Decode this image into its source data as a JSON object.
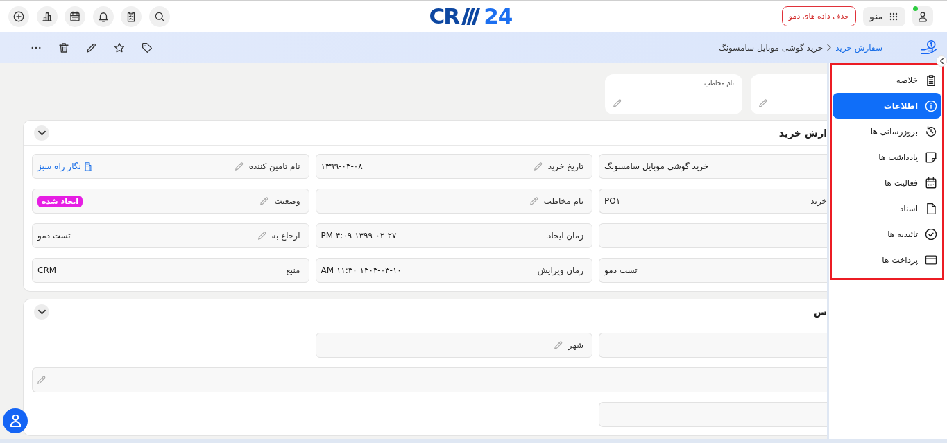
{
  "header": {
    "logo": {
      "part_1": "CR",
      "part_2": "24"
    },
    "delete_demo_button": "حذف داده های دمو",
    "menu_button": "منو",
    "user": {
      "online": true
    }
  },
  "toolbar": {
    "breadcrumb": [
      {
        "label": "سفارش خرید",
        "current": false
      },
      {
        "label": "خرید گوشی موبایل سامسونگ",
        "current": true
      }
    ]
  },
  "summary_cards": [
    {
      "editable": true
    },
    {
      "label": "نام مخاطب",
      "editable": true
    }
  ],
  "sections": [
    {
      "title": "ارش خرید",
      "rows": [
        {
          "kind": "grid",
          "fields": [
            {
              "kind": "text",
              "value": "خرید گوشی موبایل سامسونگ",
              "editable": false
            },
            {
              "kind": "text",
              "label": "تاریخ خرید",
              "value": "۱۳۹۹-۰۳-۰۸",
              "editable": true
            },
            {
              "kind": "link",
              "label": "نام تامین کننده",
              "value": "نگار راه سبز",
              "editable": true
            }
          ]
        },
        {
          "kind": "grid",
          "fields": [
            {
              "kind": "text",
              "label": "خرید",
              "value": "PO۱",
              "editable": false
            },
            {
              "label": "نام مخاطب",
              "editable": true
            },
            {
              "kind": "badge",
              "label": "وضعیت",
              "value": "ایجاد شده",
              "color": "#e61ee3",
              "editable": true
            }
          ]
        },
        {
          "kind": "grid",
          "fields": [
            {
              "editable": false
            },
            {
              "kind": "text",
              "label": "زمان ایجاد",
              "value": "۱۳۹۹-۰۲-۲۷ ۴:۰۹ PM",
              "editable": false
            },
            {
              "kind": "text",
              "label": "ارجاع به",
              "value": "تست دمو",
              "editable": true
            }
          ]
        },
        {
          "kind": "grid",
          "fields": [
            {
              "kind": "text",
              "value": "تست دمو",
              "editable": false
            },
            {
              "kind": "text",
              "label": "زمان ویرایش",
              "value": "۱۴۰۳-۰۳-۱۰ ۱۱:۳۰ AM",
              "editable": false
            },
            {
              "kind": "text",
              "label": "منبع",
              "value": "CRM",
              "editable": false
            }
          ]
        }
      ]
    },
    {
      "title": "س",
      "rows": [
        {
          "kind": "grid",
          "fields": [
            {
              "editable": false
            },
            {
              "label": "شهر",
              "editable": true
            }
          ]
        },
        {
          "kind": "wide",
          "fields": [
            {
              "editable": true
            }
          ]
        },
        {
          "kind": "grid",
          "fields": [
            {
              "editable": false
            }
          ]
        }
      ]
    }
  ],
  "side_menu": [
    {
      "label": "خلاصه",
      "selected": false
    },
    {
      "label": "اطلاعات",
      "selected": true
    },
    {
      "label": "بروزرسانی ها",
      "selected": false
    },
    {
      "label": "یادداشت ها",
      "selected": false
    },
    {
      "label": "فعالیت ها",
      "selected": false
    },
    {
      "label": "اسناد",
      "selected": false
    },
    {
      "label": "تائیدیه ها",
      "selected": false
    },
    {
      "label": "پرداخت ها",
      "selected": false
    }
  ]
}
